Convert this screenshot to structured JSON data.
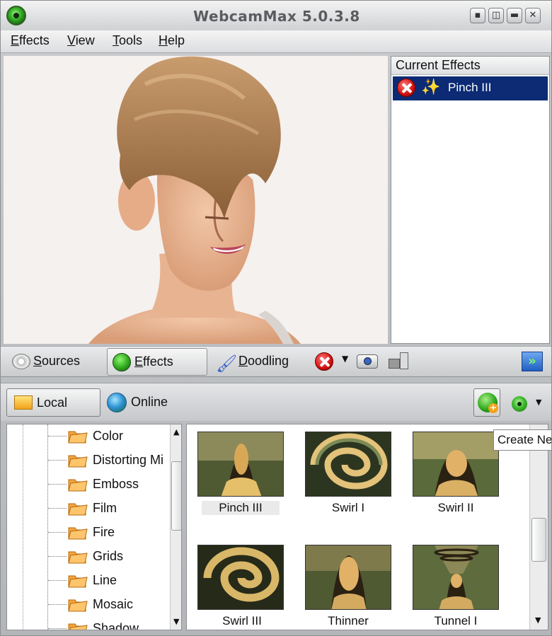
{
  "window": {
    "title": "WebcamMax  5.0.3.8"
  },
  "menu": [
    "Effects",
    "View",
    "Tools",
    "Help"
  ],
  "current_effects": {
    "header": "Current Effects",
    "items": [
      {
        "name": "Pinch III"
      }
    ]
  },
  "toolbar": {
    "sources": "Sources",
    "effects": "Effects",
    "doodling": "Doodling"
  },
  "library": {
    "local": "Local",
    "online": "Online",
    "tooltip": "Create Ne"
  },
  "tree": {
    "items": [
      "Color",
      "Distorting Mi",
      "Emboss",
      "Film",
      "Fire",
      "Grids",
      "Line",
      "Mosaic",
      "Shadow"
    ]
  },
  "gallery": {
    "items": [
      "Pinch III",
      "Swirl I",
      "Swirl II",
      "Swirl III",
      "Thinner",
      "Tunnel I"
    ]
  },
  "colors": {
    "selection": "#0c2b74",
    "accent_green": "#3cbb2b"
  }
}
